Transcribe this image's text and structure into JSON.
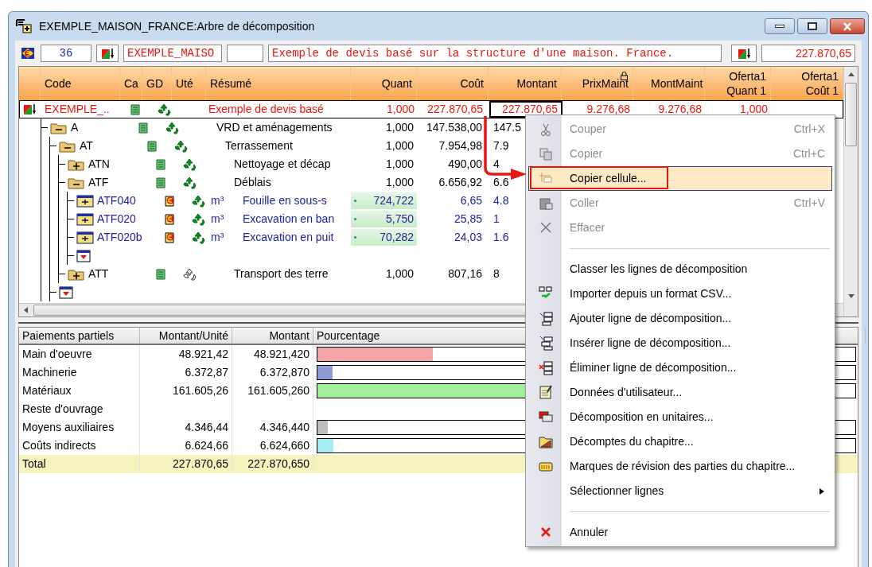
{
  "window": {
    "title": "EXEMPLE_MAISON_FRANCE:Arbre de décomposition"
  },
  "toolbar": {
    "count": "36",
    "code": "EXEMPLE_MAISO",
    "description": "Exemple de devis basé sur la structure d'une maison. France.",
    "total": "227.870,65"
  },
  "grid": {
    "columns": [
      {
        "label": "Code",
        "locked": false
      },
      {
        "label": "Ca",
        "locked": false
      },
      {
        "label": "GD",
        "locked": false
      },
      {
        "label": "Uté",
        "locked": false
      },
      {
        "label": "Résumé",
        "locked": false
      },
      {
        "label": "Quant",
        "locked": false
      },
      {
        "label": "Coût",
        "locked": false
      },
      {
        "label": "Montant",
        "locked": false
      },
      {
        "label": "PrixMaint",
        "locked": true
      },
      {
        "label": "MontMaint",
        "locked": false
      },
      {
        "label": "Oferta1 Quant 1",
        "locked": false
      },
      {
        "label": "Oferta1 Coût 1",
        "locked": false
      }
    ],
    "rows": [
      {
        "kind": "root",
        "code": "EXEMPLE_..",
        "summary": "Exemple de devis basé",
        "quant": "1,000",
        "cost": "227.870,65",
        "montant": "227.870,65",
        "montant_selected": true,
        "prix_maint": "9.276,68",
        "mont_maint": "9.276,68",
        "oferta_quant": "1,000",
        "gd_active": true,
        "children": [
          {
            "kind": "chapter",
            "expanded": true,
            "code": "A",
            "summary": "VRD et aménagements",
            "quant": "1,000",
            "cost": "147.538,00",
            "montant": "147.5",
            "montant_selected": false,
            "gd_active": true,
            "children": [
              {
                "kind": "chapter",
                "expanded": true,
                "code": "AT",
                "summary": "Terrassement",
                "quant": "1,000",
                "cost": "7.954,98",
                "montant": "7.9",
                "montant_selected": false,
                "gd_active": true,
                "children": [
                  {
                    "kind": "chapter",
                    "expanded": false,
                    "code": "ATN",
                    "summary": "Nettoyage et décap",
                    "quant": "1,000",
                    "cost": "490,00",
                    "montant": "4",
                    "montant_selected": false,
                    "gd_active": true
                  },
                  {
                    "kind": "chapter",
                    "expanded": true,
                    "code": "ATF",
                    "summary": "Déblais",
                    "quant": "1,000",
                    "cost": "6.656,92",
                    "montant": "6.6",
                    "montant_selected": false,
                    "gd_active": true,
                    "children": [
                      {
                        "kind": "unit",
                        "code": "ATF040",
                        "unit": "m³",
                        "summary": "Fouille en sous-s",
                        "quant": "724,722",
                        "measured": true,
                        "cost": "6,65",
                        "montant": "4.8",
                        "montant_selected": false,
                        "gd_active": true
                      },
                      {
                        "kind": "unit",
                        "code": "ATF020",
                        "unit": "m³",
                        "summary": "Excavation en ban",
                        "quant": "5,750",
                        "measured": true,
                        "cost": "25,85",
                        "montant": "1",
                        "montant_selected": false,
                        "gd_active": true
                      },
                      {
                        "kind": "unit",
                        "code": "ATF020b",
                        "unit": "m³",
                        "summary": "Excavation en puit",
                        "quant": "70,282",
                        "measured": true,
                        "cost": "24,03",
                        "montant": "1.6",
                        "montant_selected": false,
                        "gd_active": true
                      },
                      {
                        "kind": "new"
                      }
                    ]
                  },
                  {
                    "kind": "chapter",
                    "expanded": false,
                    "code": "ATT",
                    "summary": "Transport des terre",
                    "quant": "1,000",
                    "cost": "807,16",
                    "montant": "8",
                    "montant_selected": false,
                    "gd_active": false
                  }
                ]
              },
              {
                "kind": "new"
              }
            ]
          }
        ]
      }
    ]
  },
  "breakdown": {
    "columns": [
      "Paiements partiels",
      "Montant/Unité",
      "Montant",
      "Pourcentage"
    ],
    "rows": [
      {
        "label": "Main d'oeuvre",
        "per_unit": "48.921,42",
        "amount": "48.921,420",
        "level": 0.215,
        "color": "#f4a5a8"
      },
      {
        "label": "Machinerie",
        "per_unit": "6.372,87",
        "amount": "6.372,870",
        "level": 0.028,
        "color": "#8e9bd6"
      },
      {
        "label": "Matériaux",
        "per_unit": "161.605,26",
        "amount": "161.605,260",
        "level": 0.709,
        "color": "#9fef9c"
      },
      {
        "label": "Reste d'ouvrage"
      },
      {
        "label": "Moyens auxiliaires",
        "per_unit": "4.346,44",
        "amount": "4.346,440",
        "level": 0.019,
        "color": "#bdbdbd"
      },
      {
        "label": "Coûts indirects",
        "per_unit": "6.624,66",
        "amount": "6.624,660",
        "level": 0.029,
        "color": "#a6eef2"
      }
    ],
    "total": {
      "label": "Total",
      "per_unit": "227.870,65",
      "amount": "227.870,650"
    }
  },
  "context_menu": {
    "items": [
      {
        "kind": "item",
        "label": "Couper",
        "shortcut": "Ctrl+X",
        "disabled": true,
        "selected": false
      },
      {
        "kind": "item",
        "label": "Copier",
        "shortcut": "Ctrl+C",
        "disabled": true,
        "selected": false
      },
      {
        "kind": "item",
        "label": "Copier cellule...",
        "disabled": false,
        "selected": true
      },
      {
        "kind": "item",
        "label": "Coller",
        "shortcut": "Ctrl+V",
        "disabled": true,
        "selected": false
      },
      {
        "kind": "item",
        "label": "Effacer",
        "disabled": true,
        "selected": false
      },
      {
        "kind": "separator"
      },
      {
        "kind": "item",
        "label": "Classer les lignes de décomposition",
        "disabled": false,
        "selected": false
      },
      {
        "kind": "item",
        "label": "Importer depuis un format CSV...",
        "disabled": false,
        "selected": false
      },
      {
        "kind": "item",
        "label": "Ajouter ligne de décomposition...",
        "disabled": false,
        "selected": false
      },
      {
        "kind": "item",
        "label": "Insérer ligne de décomposition...",
        "disabled": false,
        "selected": false
      },
      {
        "kind": "item",
        "label": "Éliminer ligne de décomposition...",
        "disabled": false,
        "selected": false
      },
      {
        "kind": "item",
        "label": "Données d'utilisateur...",
        "disabled": false,
        "selected": false
      },
      {
        "kind": "item",
        "label": "Décomposition en unitaires...",
        "disabled": false,
        "selected": false
      },
      {
        "kind": "item",
        "label": "Décomptes du chapitre...",
        "disabled": false,
        "selected": false
      },
      {
        "kind": "item",
        "label": "Marques de révision des parties du chapitre...",
        "disabled": false,
        "selected": false
      },
      {
        "kind": "submenu",
        "label": "Sélectionner lignes",
        "disabled": false,
        "selected": false
      },
      {
        "kind": "separator"
      },
      {
        "kind": "item",
        "label": "Annuler",
        "disabled": false,
        "selected": false
      }
    ]
  }
}
